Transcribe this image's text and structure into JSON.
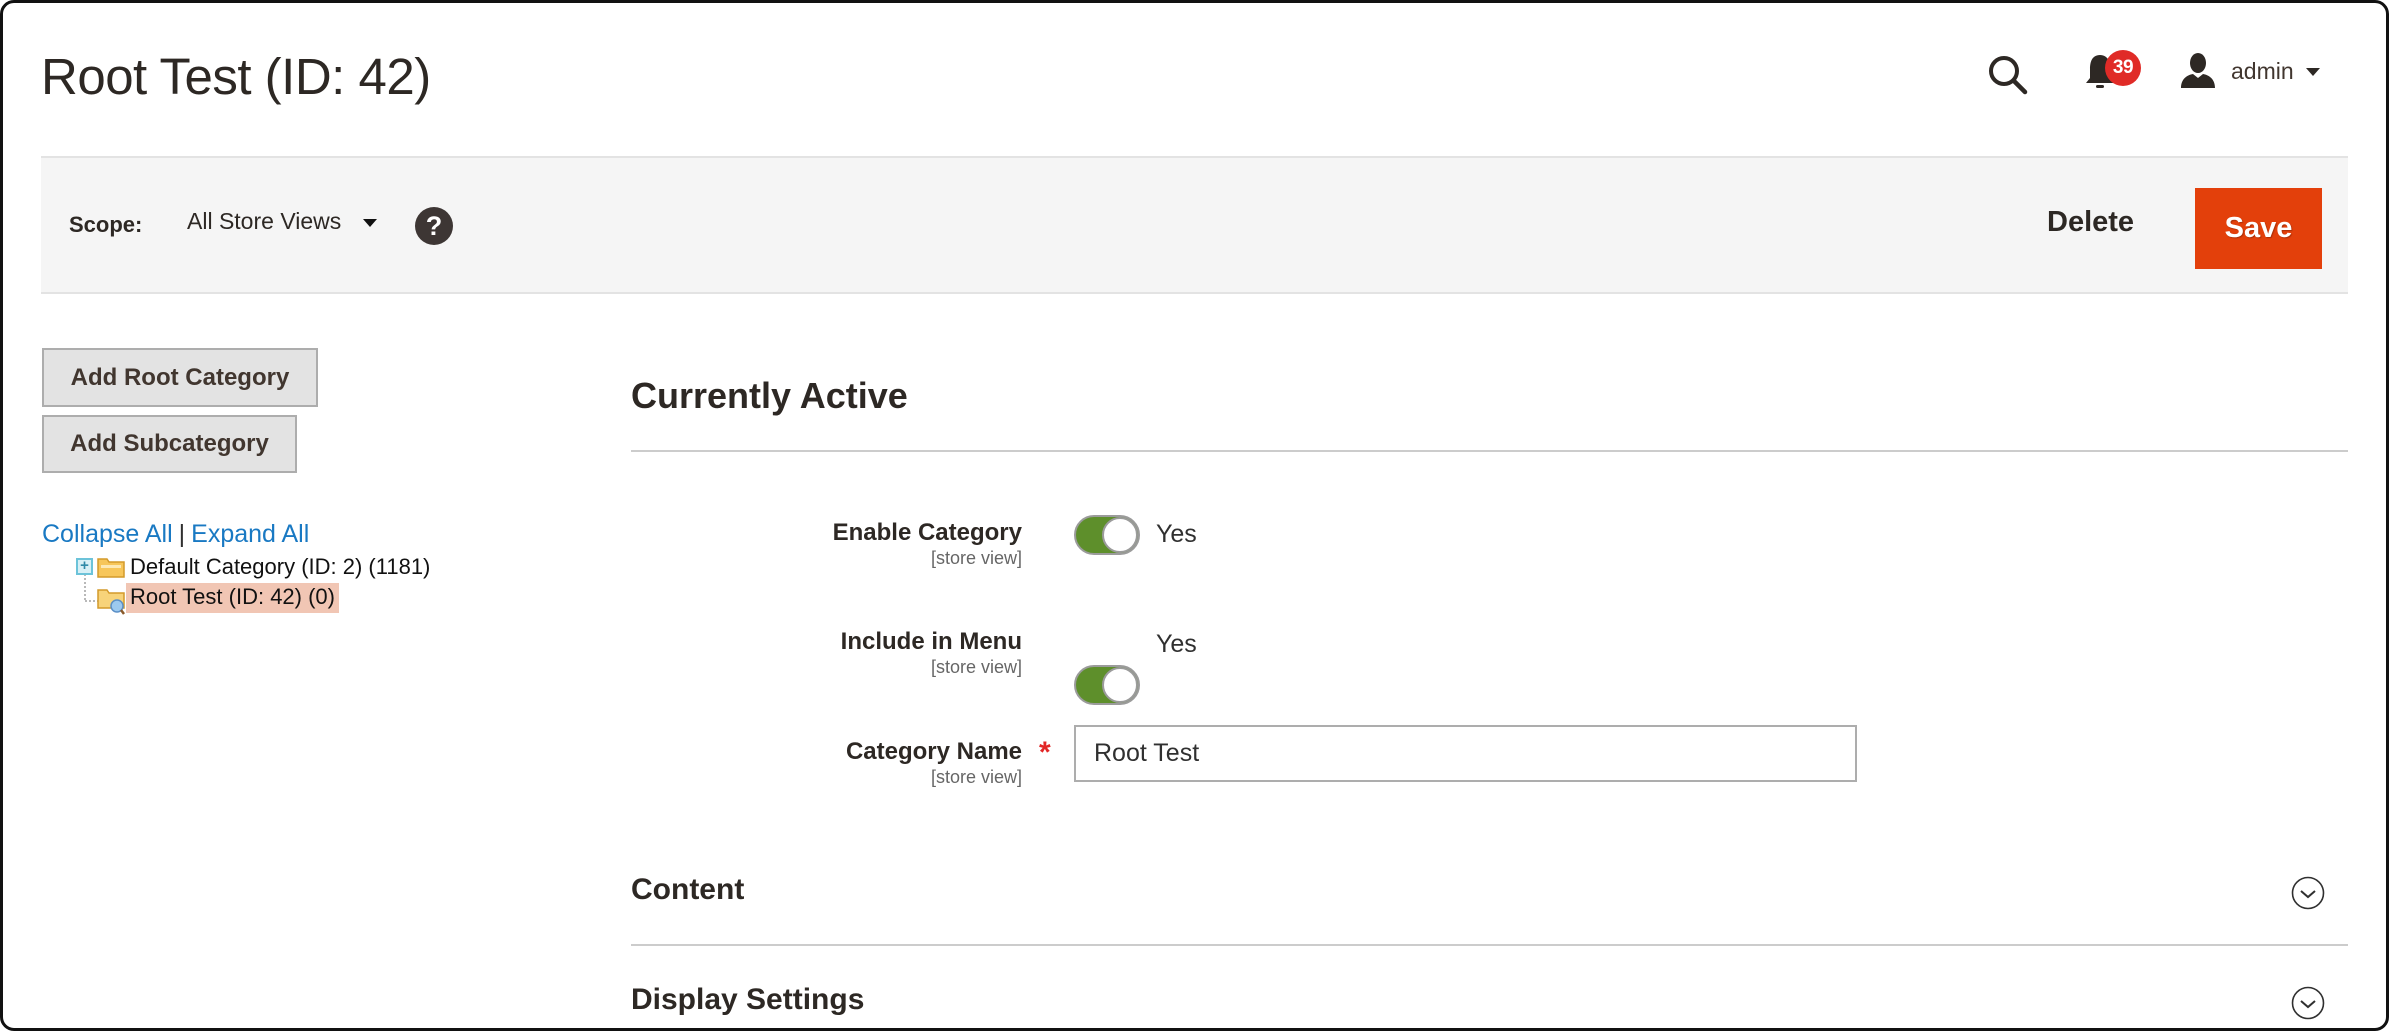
{
  "header": {
    "page_title": "Root Test (ID: 42)",
    "search_icon": "search-icon",
    "notifications": {
      "icon": "bell-icon",
      "count": "39",
      "badge_color": "#e02b27"
    },
    "user": {
      "icon": "user-icon",
      "name": "admin"
    }
  },
  "scope_bar": {
    "label": "Scope:",
    "selected": "All Store Views",
    "help_icon": "?",
    "delete_label": "Delete",
    "save_label": "Save",
    "save_color": "#e3400b"
  },
  "sidebar": {
    "add_root_label": "Add Root Category",
    "add_sub_label": "Add Subcategory",
    "collapse_all": "Collapse All",
    "separator": "|",
    "expand_all": "Expand All",
    "tree": [
      {
        "label": "Default Category (ID: 2) (1181)",
        "expandable": true,
        "selected": false
      },
      {
        "label": "Root Test (ID: 42) (0)",
        "expandable": false,
        "selected": true
      }
    ],
    "selected_highlight": "#f1c6b4"
  },
  "main": {
    "section_title": "Currently Active",
    "fields": {
      "enable_category": {
        "label": "Enable Category",
        "scope": "[store view]",
        "value": "Yes",
        "on": true
      },
      "include_in_menu": {
        "label": "Include in Menu",
        "scope": "[store view]",
        "value": "Yes",
        "on": true
      },
      "category_name": {
        "label": "Category Name",
        "scope": "[store view]",
        "required_mark": "*",
        "value": "Root Test"
      }
    },
    "toggle_color": "#5e8f2b",
    "collapsibles": [
      {
        "title": "Content"
      },
      {
        "title": "Display Settings"
      }
    ]
  }
}
